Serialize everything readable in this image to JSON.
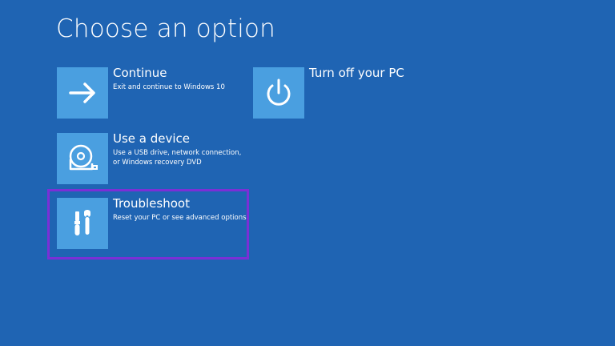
{
  "screen": {
    "title": "Choose an option"
  },
  "options": [
    {
      "label": "Continue",
      "description": [
        "Exit and continue to Windows 10"
      ],
      "icon": "arrow-right-icon"
    },
    {
      "label": "Use a device",
      "description": [
        "Use a USB drive, network connection,",
        "or Windows recovery DVD"
      ],
      "icon": "disc-drive-icon"
    },
    {
      "label": "Troubleshoot",
      "description": [
        "Reset your PC or see advanced options"
      ],
      "icon": "tools-icon",
      "highlighted": true
    },
    {
      "label": "Turn off your PC",
      "description": [],
      "icon": "power-icon"
    }
  ],
  "colors": {
    "background": "#1f64b3",
    "tile": "#4a9fe0",
    "highlight": "#7b2fd6",
    "text": "#ffffff"
  }
}
